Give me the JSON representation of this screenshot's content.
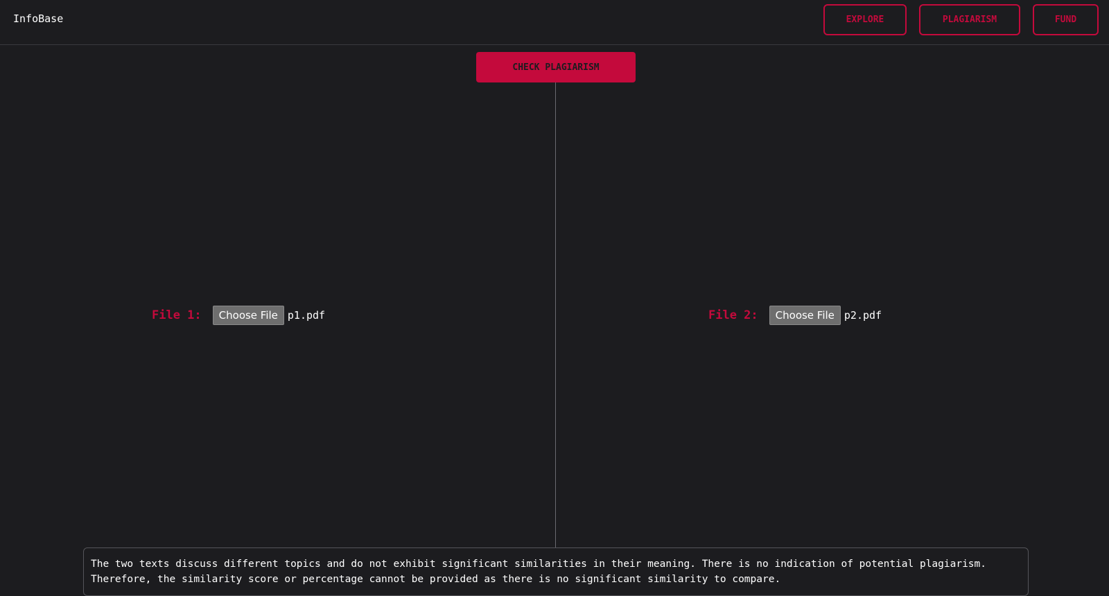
{
  "header": {
    "brand": "InfoBase",
    "nav": {
      "explore": "EXPLORE",
      "plagiarism": "PLAGIARISM",
      "fund": "FUND"
    }
  },
  "main": {
    "check_button": "CHECK PLAGIARISM",
    "file1": {
      "label": "File 1:",
      "button": "Choose File",
      "filename": "p1.pdf"
    },
    "file2": {
      "label": "File 2:",
      "button": "Choose File",
      "filename": "p2.pdf"
    },
    "result": "The two texts discuss different topics and do not exhibit significant similarities in their meaning. There is no indication of potential plagiarism. Therefore, the similarity score or percentage cannot be provided as there is no significant similarity to compare."
  },
  "colors": {
    "background": "#1c1c1f",
    "accent": "#c40a3c",
    "text": "#ffffff"
  }
}
